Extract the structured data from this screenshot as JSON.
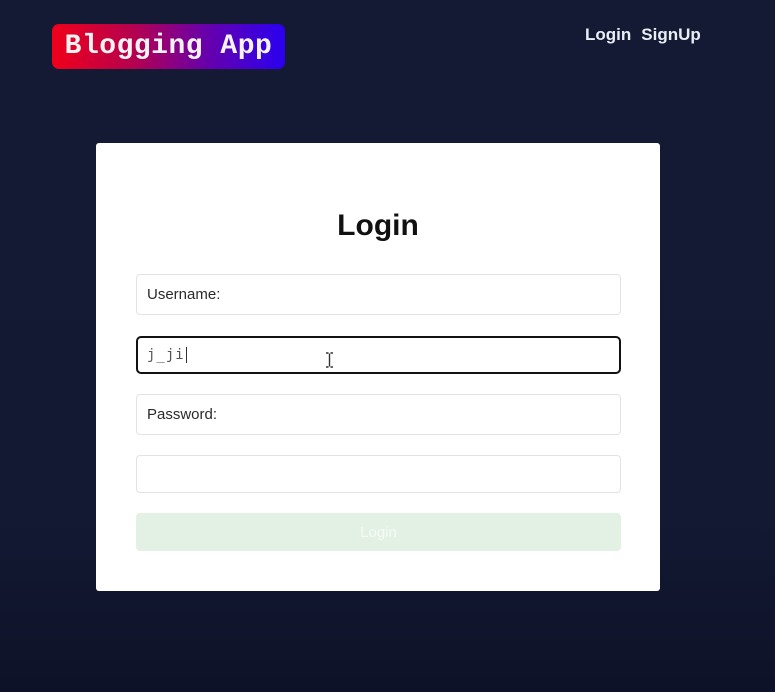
{
  "header": {
    "brand": "Blogging App",
    "nav": {
      "login": "Login",
      "signup": "SignUp"
    }
  },
  "form": {
    "title": "Login",
    "username_label": "Username:",
    "username_value": "j_ji",
    "password_label": "Password:",
    "password_value": "",
    "submit_label": "Login"
  },
  "colors": {
    "background": "#141a33",
    "brand_gradient_start": "#f0001a",
    "brand_gradient_end": "#2a00f0",
    "submit_bg": "#e3f1e4"
  },
  "icons": {
    "cursor": "text-cursor-icon"
  }
}
